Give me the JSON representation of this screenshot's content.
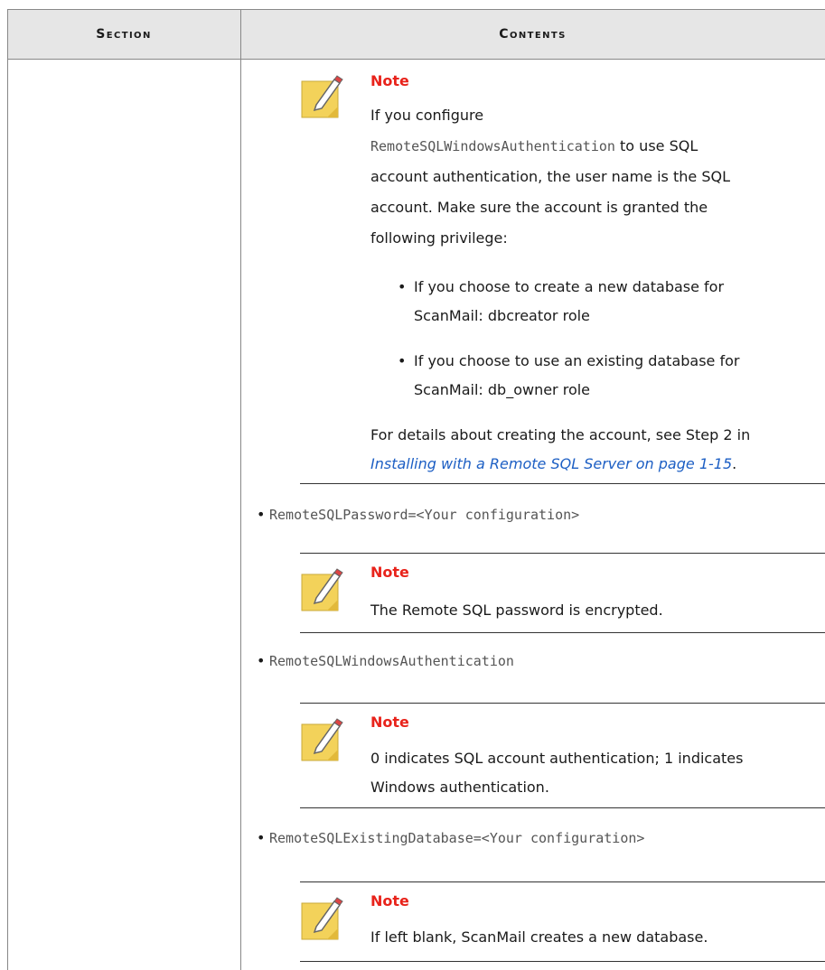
{
  "table": {
    "headers": {
      "section": "Section",
      "contents": "Contents"
    }
  },
  "notes": [
    {
      "title": "Note",
      "intro": "If you configure",
      "code": "RemoteSQLWindowsAuthentication",
      "after_code": " to use SQL",
      "line3": "account authentication, the user name is the SQL",
      "line4": "account. Make sure the account is granted the",
      "line5": "following privilege:",
      "bullet1_a": "If you choose to create a new database for",
      "bullet1_b": "ScanMail: dbcreator role",
      "bullet2_a": "If you choose to use an existing database for",
      "bullet2_b": "ScanMail: db_owner role",
      "details": "For details about creating the account, see Step 2 in",
      "link": "Installing with a Remote SQL Server on page 1-15",
      "link_tail": "."
    },
    {
      "title": "Note",
      "line1": "The Remote SQL password is encrypted."
    },
    {
      "title": "Note",
      "line1": "0 indicates SQL account authentication; 1 indicates",
      "line2": "Windows authentication."
    },
    {
      "title": "Note",
      "line1": "If left blank, ScanMail creates a new database."
    }
  ],
  "settings": [
    "RemoteSQLPassword=<Your configuration>",
    "RemoteSQLWindowsAuthentication",
    "RemoteSQLExistingDatabase=<Your configuration>"
  ],
  "bullet_char": "•",
  "icons": {
    "note": "note-pencil-icon"
  }
}
